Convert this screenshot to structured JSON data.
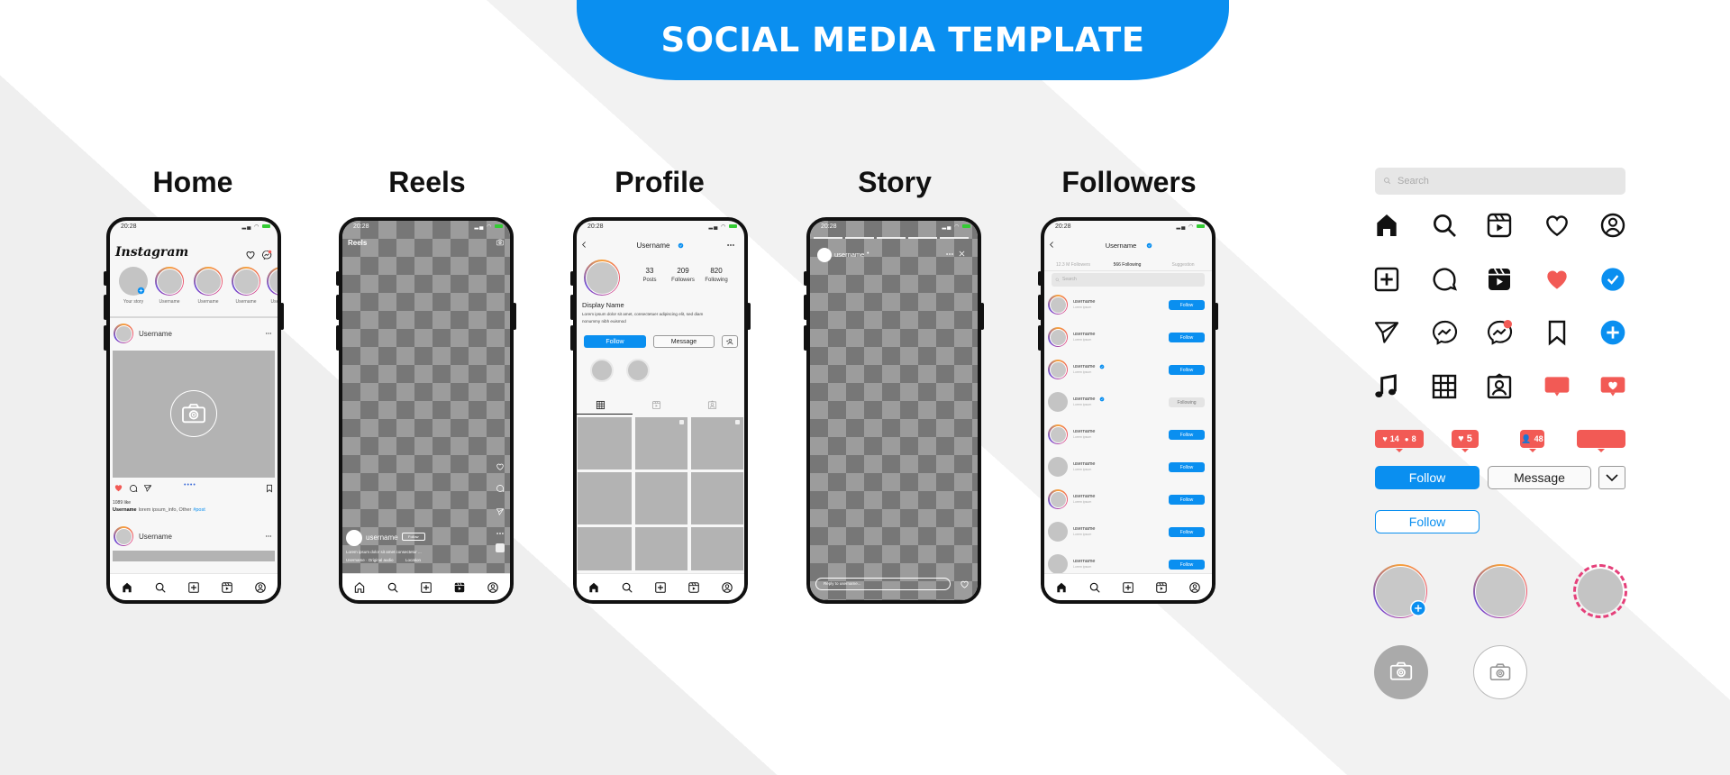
{
  "title": "SOCIAL MEDIA TEMPLATE",
  "colors": {
    "accent": "#0a8ff0",
    "like": "#f25a55",
    "text": "#111111"
  },
  "screens": {
    "home": {
      "label": "Home",
      "time": "20:28",
      "logo": "Instagram",
      "stories": [
        "Your story",
        "Username",
        "Username",
        "Username",
        "Username"
      ],
      "posts": [
        {
          "username": "Username"
        },
        {
          "username": "Username"
        }
      ],
      "likes": "1089 like",
      "caption_user": "Username",
      "caption_text": "lorem ipsum_info, Other",
      "caption_tag": "#post"
    },
    "reels": {
      "label": "Reels",
      "time": "20:28",
      "title": "Reels",
      "username": "username",
      "follow": "Follow",
      "caption": "Lorem ipsum dolor sit amet consectetur ...",
      "music": "Username · Original audio",
      "location": "Location"
    },
    "profile": {
      "label": "Profile",
      "time": "20:28",
      "username": "Username",
      "stats": [
        {
          "value": "33",
          "label": "Posts"
        },
        {
          "value": "209",
          "label": "Followers"
        },
        {
          "value": "820",
          "label": "Following"
        }
      ],
      "display_name": "Display Name",
      "bio": "Lorem ipsum dolor sit amet, consectetuer adipiscing elit, sed diam nonummy nibh euismod",
      "follow": "Follow",
      "message": "Message"
    },
    "story": {
      "label": "Story",
      "time": "20:28",
      "username": "username",
      "reply_placeholder": "Reply to username..."
    },
    "followers": {
      "label": "Followers",
      "time": "20:28",
      "username": "Username",
      "tabs": [
        "12.3 M Followers",
        "566 Following",
        "Suggestion"
      ],
      "active_tab": 1,
      "search_placeholder": "Search",
      "rows": [
        {
          "name": "username",
          "sub": "Lorem ipsum",
          "verified": false,
          "story": true,
          "action": "Follow"
        },
        {
          "name": "username",
          "sub": "Lorem ipsum",
          "verified": false,
          "story": true,
          "action": "Follow"
        },
        {
          "name": "username",
          "sub": "Lorem ipsum",
          "verified": true,
          "story": true,
          "action": "Follow"
        },
        {
          "name": "username",
          "sub": "Lorem ipsum",
          "verified": true,
          "story": false,
          "action": "Following"
        },
        {
          "name": "username",
          "sub": "Lorem ipsum",
          "verified": false,
          "story": true,
          "action": "Follow"
        },
        {
          "name": "username",
          "sub": "Lorem ipsum",
          "verified": false,
          "story": false,
          "action": "Follow"
        },
        {
          "name": "username",
          "sub": "Lorem ipsum",
          "verified": false,
          "story": true,
          "action": "Follow"
        },
        {
          "name": "username",
          "sub": "Lorem ipsum",
          "verified": false,
          "story": false,
          "action": "Follow"
        },
        {
          "name": "username",
          "sub": "Lorem ipsum",
          "verified": false,
          "story": false,
          "action": "Follow"
        }
      ]
    }
  },
  "nav_icons": [
    "home",
    "search",
    "plus-square",
    "reels",
    "profile"
  ],
  "kit": {
    "search_placeholder": "Search",
    "icons": [
      "home",
      "search",
      "reels",
      "heart",
      "profile",
      "plus-square",
      "comment",
      "reels-filled",
      "heart-filled",
      "verified",
      "send",
      "messenger",
      "messenger-notification",
      "bookmark",
      "plus-circle",
      "music",
      "grid",
      "tagged",
      "notification-bubble",
      "notification-heart"
    ],
    "badges": [
      {
        "likes": "14",
        "comments": "8"
      },
      {
        "likes": "5"
      },
      {
        "followers": "48"
      }
    ],
    "follow": "Follow",
    "message": "Message",
    "follow_outline": "Follow"
  }
}
